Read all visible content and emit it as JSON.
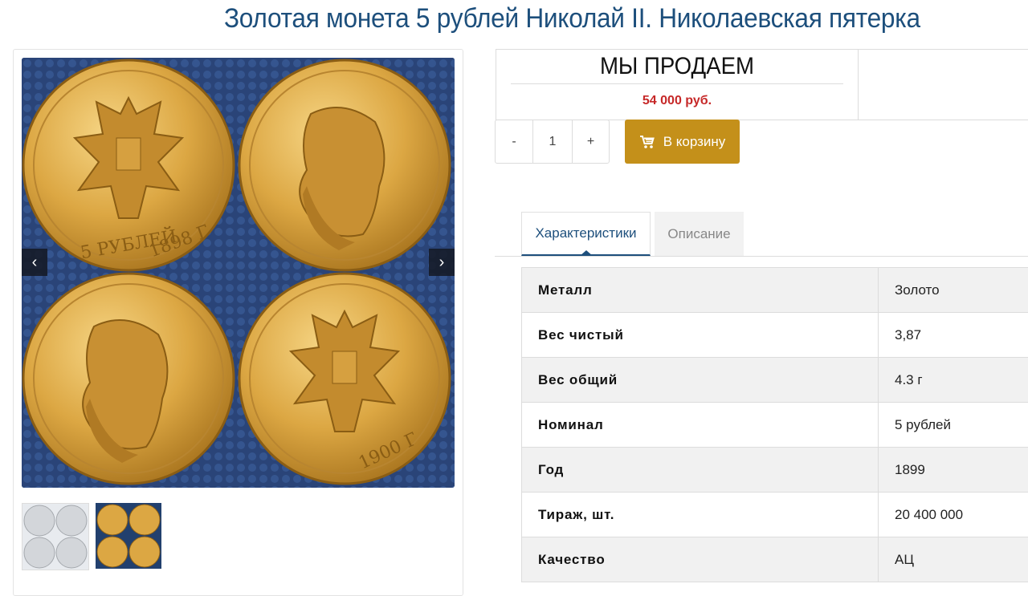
{
  "page": {
    "title": "Золотая монета 5 рублей Николай II. Николаевская пятерка"
  },
  "gallery": {
    "prev_icon": "‹",
    "next_icon": "›",
    "coin_inscriptions": {
      "denomination": "5 РУБЛЕЙ",
      "year_1": "1898 Г",
      "year_2": "1900 Г"
    }
  },
  "offer": {
    "heading": "МЫ ПРОДАЕМ",
    "price": "54 000 руб."
  },
  "quantity": {
    "minus": "-",
    "value": "1",
    "plus": "+"
  },
  "cart": {
    "label": "В корзину",
    "color": "#c4901a"
  },
  "tabs": [
    {
      "label": "Характеристики",
      "active": true
    },
    {
      "label": "Описание",
      "active": false
    }
  ],
  "specs": [
    {
      "key": "Металл",
      "value": "Золото"
    },
    {
      "key": "Вес чистый",
      "value": "3,87"
    },
    {
      "key": "Вес общий",
      "value": "4.3 г"
    },
    {
      "key": "Номинал",
      "value": "5 рублей"
    },
    {
      "key": "Год",
      "value": "1899"
    },
    {
      "key": "Тираж, шт.",
      "value": "20 400 000"
    },
    {
      "key": "Качество",
      "value": "АЦ"
    }
  ],
  "colors": {
    "title": "#1d4f7c",
    "price": "#c62828",
    "gold": "#d9a436"
  }
}
